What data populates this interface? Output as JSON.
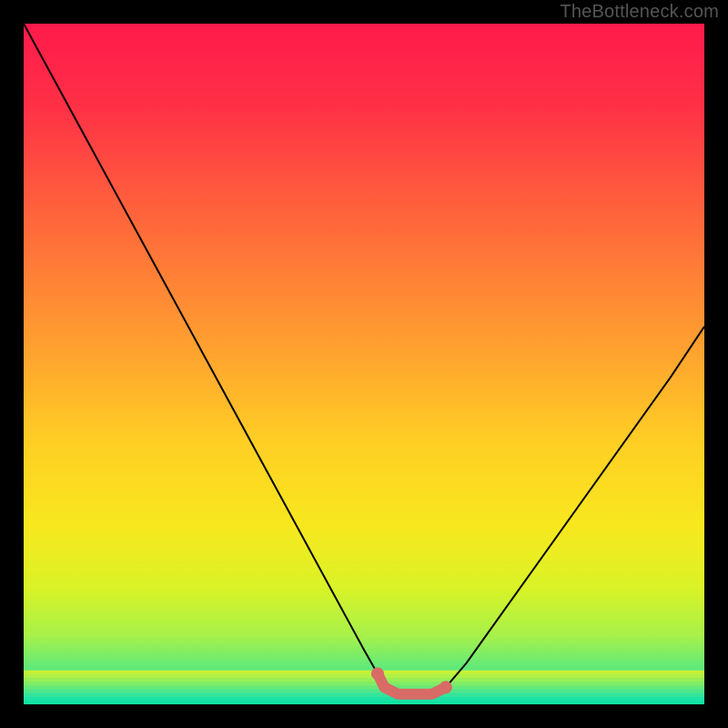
{
  "watermark": {
    "text": "TheBottleneck.com"
  },
  "chart_data": {
    "type": "line",
    "title": "",
    "xlabel": "",
    "ylabel": "",
    "xlim": [
      0,
      100
    ],
    "ylim": [
      0,
      100
    ],
    "grid": false,
    "legend": false,
    "annotations": [],
    "series": [
      {
        "name": "bottleneck-curve",
        "color": "#000000",
        "x": [
          0,
          5,
          10,
          15,
          20,
          25,
          30,
          35,
          40,
          45,
          50,
          52,
          55,
          58,
          60,
          62,
          65,
          70,
          75,
          80,
          85,
          90,
          95,
          100
        ],
        "y": [
          100,
          90.8,
          81.6,
          72.4,
          63.2,
          54.0,
          44.8,
          35.6,
          26.4,
          17.2,
          8.0,
          4.5,
          1.5,
          1.5,
          1.5,
          2.5,
          6.0,
          13.0,
          20.0,
          27.0,
          34.0,
          41.0,
          48.0,
          55.5
        ]
      },
      {
        "name": "optimal-zone-marker",
        "color": "#d86b66",
        "x": [
          52,
          53,
          55,
          58,
          60,
          61,
          62
        ],
        "y": [
          4.5,
          2.5,
          1.5,
          1.5,
          1.5,
          2.0,
          2.5
        ]
      }
    ],
    "background_gradient": {
      "stops": [
        {
          "offset": 0.0,
          "color": "#ff1a4b"
        },
        {
          "offset": 0.12,
          "color": "#ff3046"
        },
        {
          "offset": 0.3,
          "color": "#ff6a3a"
        },
        {
          "offset": 0.48,
          "color": "#ffa22f"
        },
        {
          "offset": 0.62,
          "color": "#ffd024"
        },
        {
          "offset": 0.74,
          "color": "#f7e81e"
        },
        {
          "offset": 0.83,
          "color": "#d9f327"
        },
        {
          "offset": 0.9,
          "color": "#a6f14a"
        },
        {
          "offset": 0.95,
          "color": "#5be97e"
        },
        {
          "offset": 1.0,
          "color": "#13e3a0"
        }
      ]
    },
    "green_band": {
      "top_fraction": 0.95,
      "stripes": [
        "#c7f238",
        "#b0f145",
        "#98ef55",
        "#80ec66",
        "#67e978",
        "#4ee68a",
        "#36e49a",
        "#1de3a6",
        "#13e3a0"
      ]
    }
  }
}
